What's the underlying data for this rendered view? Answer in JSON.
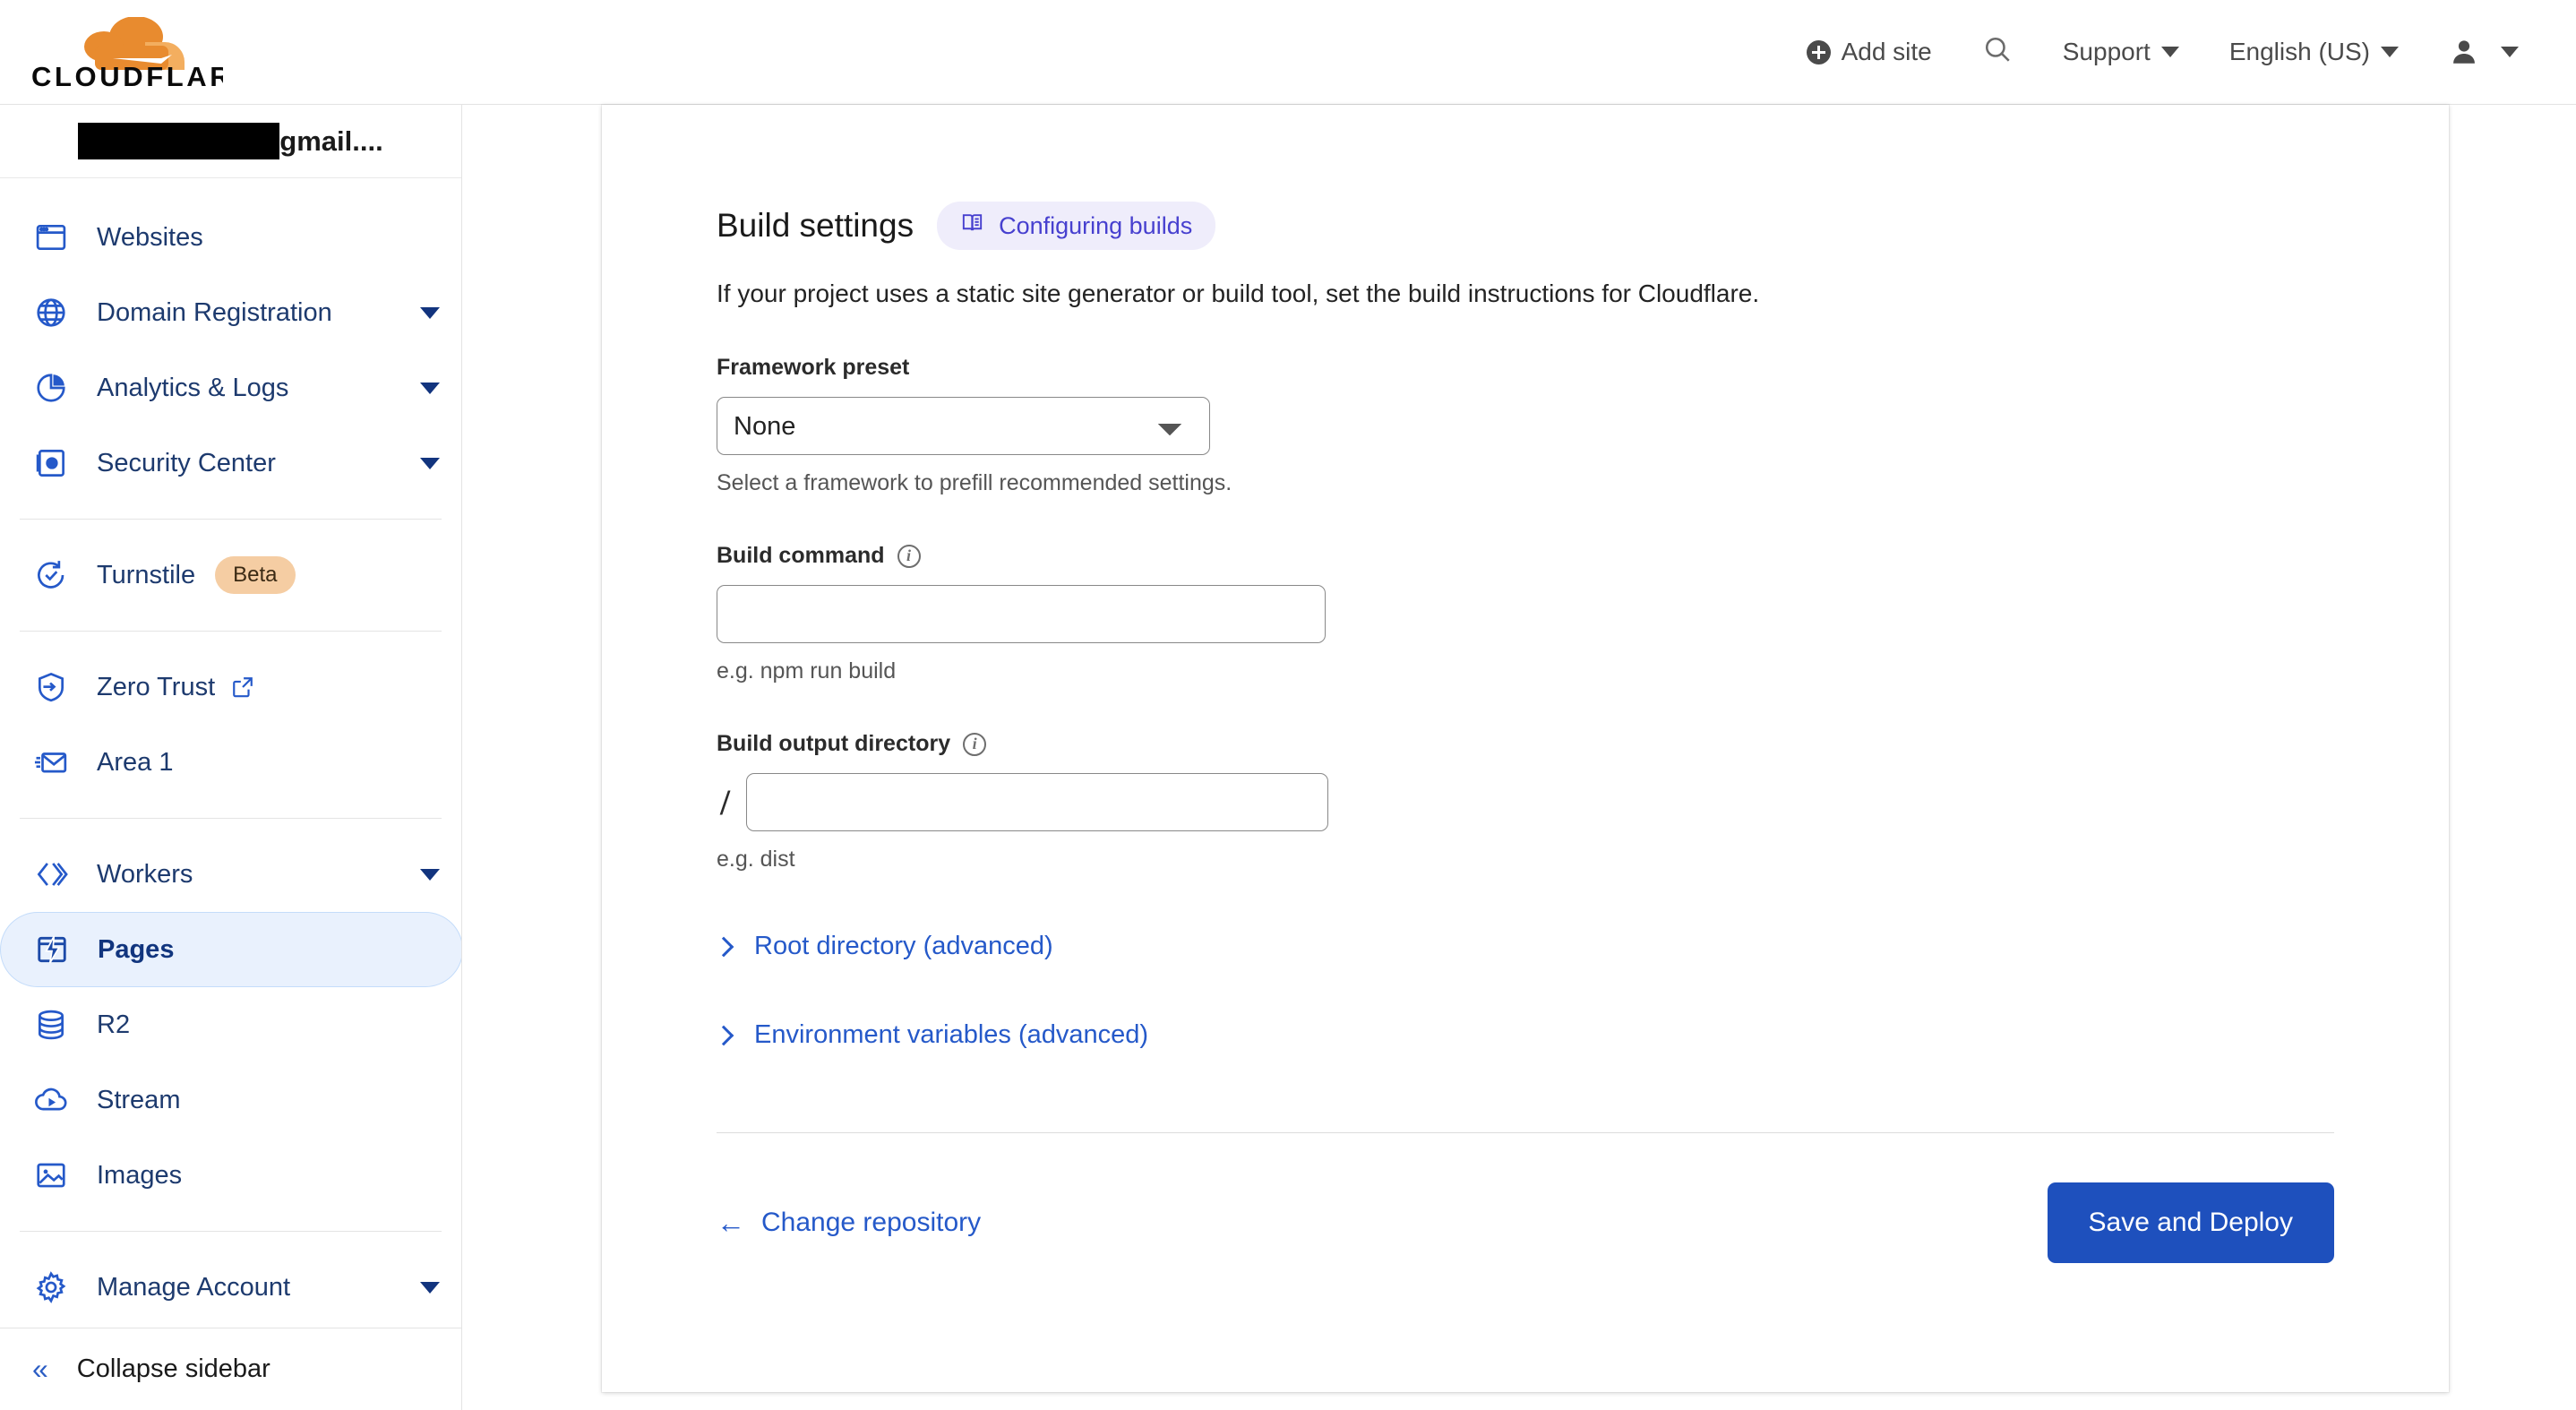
{
  "topbar": {
    "logo_name": "cloudflare-logo",
    "logo_wordmark": "CLOUDFLARE",
    "add_site_label": "Add site",
    "search_icon": "search-icon",
    "support_label": "Support",
    "language_label": "English (US)",
    "account_icon": "user-avatar-icon"
  },
  "sidebar": {
    "account_suffix": "gmail....",
    "items": [
      {
        "label": "Websites",
        "icon": "browser-window-icon",
        "caret": false,
        "active": false
      },
      {
        "label": "Domain Registration",
        "icon": "globe-icon",
        "caret": true,
        "active": false
      },
      {
        "label": "Analytics & Logs",
        "icon": "pie-chart-icon",
        "caret": true,
        "active": false
      },
      {
        "label": "Security Center",
        "icon": "safe-vault-icon",
        "caret": true,
        "active": false
      },
      {
        "label": "Turnstile",
        "icon": "rotate-check-icon",
        "caret": false,
        "active": false,
        "badge": "Beta"
      },
      {
        "label": "Zero Trust",
        "icon": "shield-arrow-icon",
        "caret": false,
        "active": false,
        "external": true
      },
      {
        "label": "Area 1",
        "icon": "envelope-icon",
        "caret": false,
        "active": false
      },
      {
        "label": "Workers",
        "icon": "workers-brackets-icon",
        "caret": true,
        "active": false
      },
      {
        "label": "Pages",
        "icon": "pages-bolt-icon",
        "caret": false,
        "active": true
      },
      {
        "label": "R2",
        "icon": "database-icon",
        "caret": false,
        "active": false
      },
      {
        "label": "Stream",
        "icon": "cloud-play-icon",
        "caret": false,
        "active": false
      },
      {
        "label": "Images",
        "icon": "image-icon",
        "caret": false,
        "active": false
      },
      {
        "label": "Manage Account",
        "icon": "gear-icon",
        "caret": true,
        "active": false
      }
    ],
    "collapse_label": "Collapse sidebar",
    "collapse_icon": "double-chevron-left-icon"
  },
  "main": {
    "title": "Build settings",
    "doc_badge": {
      "label": "Configuring builds",
      "icon": "book-icon"
    },
    "description": "If your project uses a static site generator or build tool, set the build instructions for Cloudflare.",
    "framework_preset": {
      "label": "Framework preset",
      "value": "None",
      "options": [
        "None"
      ],
      "hint": "Select a framework to prefill recommended settings."
    },
    "build_command": {
      "label": "Build command",
      "value": "",
      "placeholder": "",
      "hint": "e.g. npm run build",
      "info_icon": "info-icon"
    },
    "build_output_directory": {
      "label": "Build output directory",
      "prefix": "/",
      "value": "",
      "placeholder": "",
      "hint": "e.g. dist",
      "info_icon": "info-icon"
    },
    "expanders": [
      {
        "label": "Root directory (advanced)"
      },
      {
        "label": "Environment variables (advanced)"
      }
    ],
    "footer": {
      "change_repo_label": "Change repository",
      "back_arrow": "←",
      "save_deploy_label": "Save and Deploy"
    }
  },
  "colors": {
    "brand_orange": "#f48120",
    "primary_blue": "#1e50bd",
    "link_blue": "#2559c9",
    "nav_blue": "#1d3a6e",
    "badge_lavender": "#efedfb",
    "badge_indigo": "#4740cf",
    "beta_peach": "#f5cda3"
  }
}
